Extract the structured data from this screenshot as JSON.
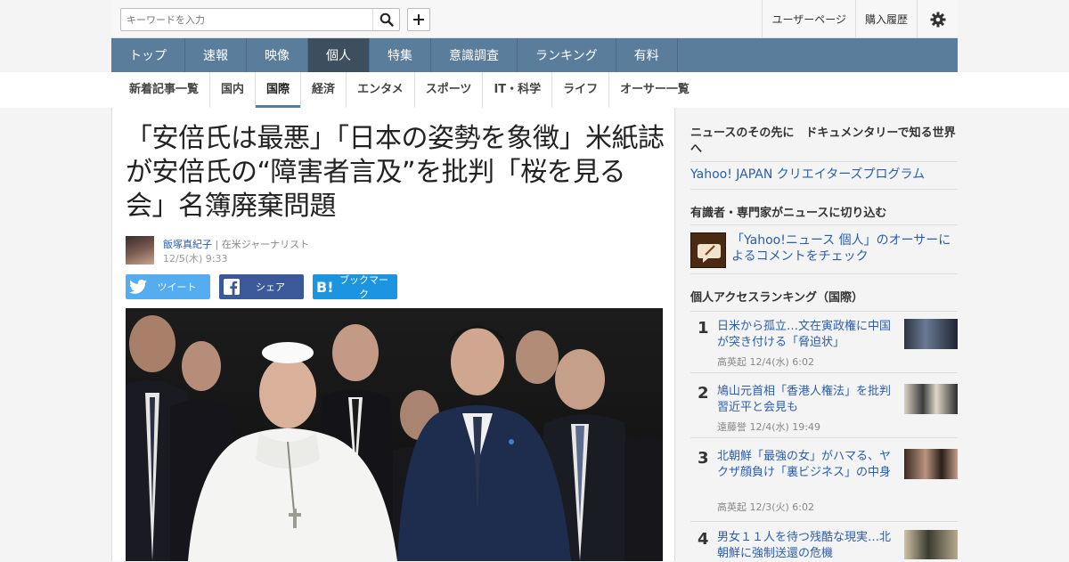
{
  "search": {
    "placeholder": "キーワードを入力"
  },
  "toplinks": {
    "user_page": "ユーザーページ",
    "purchase_history": "購入履歴"
  },
  "nav": [
    {
      "label": "トップ"
    },
    {
      "label": "速報"
    },
    {
      "label": "映像"
    },
    {
      "label": "個人",
      "active": true
    },
    {
      "label": "特集"
    },
    {
      "label": "意識調査"
    },
    {
      "label": "ランキング"
    },
    {
      "label": "有料"
    }
  ],
  "subnav": [
    {
      "label": "新着記事一覧"
    },
    {
      "label": "国内"
    },
    {
      "label": "国際",
      "active": true
    },
    {
      "label": "経済"
    },
    {
      "label": "エンタメ"
    },
    {
      "label": "スポーツ"
    },
    {
      "label": "IT・科学"
    },
    {
      "label": "ライフ"
    },
    {
      "label": "オーサー一覧"
    }
  ],
  "article": {
    "title": "「安倍氏は最悪」「日本の姿勢を象徴」米紙誌が安倍氏の“障害者言及”を批判「桜を見る会」名簿廃棄問題",
    "author_name": "飯塚真紀子",
    "author_role": "在米ジャーナリスト",
    "date": "12/5(木) 9:33"
  },
  "share": {
    "tweet": "ツイート",
    "share": "シェア",
    "bookmark": "ブックマーク"
  },
  "sidebar": {
    "doc_heading": "ニュースのその先に　ドキュメンタリーで知る世界へ",
    "doc_link": "Yahoo! JAPAN クリエイターズプログラム",
    "experts_heading": "有識者・専門家がニュースに切り込む",
    "experts_link": "「Yahoo!ニュース 個人」のオーサーによるコメントをチェック",
    "ranking_heading": "個人アクセスランキング（国際）",
    "ranking": [
      {
        "rank": "1",
        "title": "日米から孤立…文在寅政権に中国が突き付ける「脅迫状」",
        "author": "高英起",
        "date": "12/4(水) 6:02"
      },
      {
        "rank": "2",
        "title": "鳩山元首相「香港人権法」を批判　習近平と会見も",
        "author": "遠藤誉",
        "date": "12/4(水) 19:49"
      },
      {
        "rank": "3",
        "title": "北朝鮮「最強の女」がハマる、ヤクザ顔負け「裏ビジネス」の中身",
        "author": "高英起",
        "date": "12/3(火) 6:02"
      },
      {
        "rank": "4",
        "title": "男女１１人を待つ残酷な現実…北朝鮮に強制送還の危機",
        "author": "",
        "date": ""
      }
    ]
  },
  "colors": {
    "nav": "#5a7d9c",
    "nav_active": "#3d4f5f",
    "link": "#2a5db0",
    "twitter": "#55acee",
    "facebook": "#3b5998",
    "hatena": "#1b95e0"
  }
}
